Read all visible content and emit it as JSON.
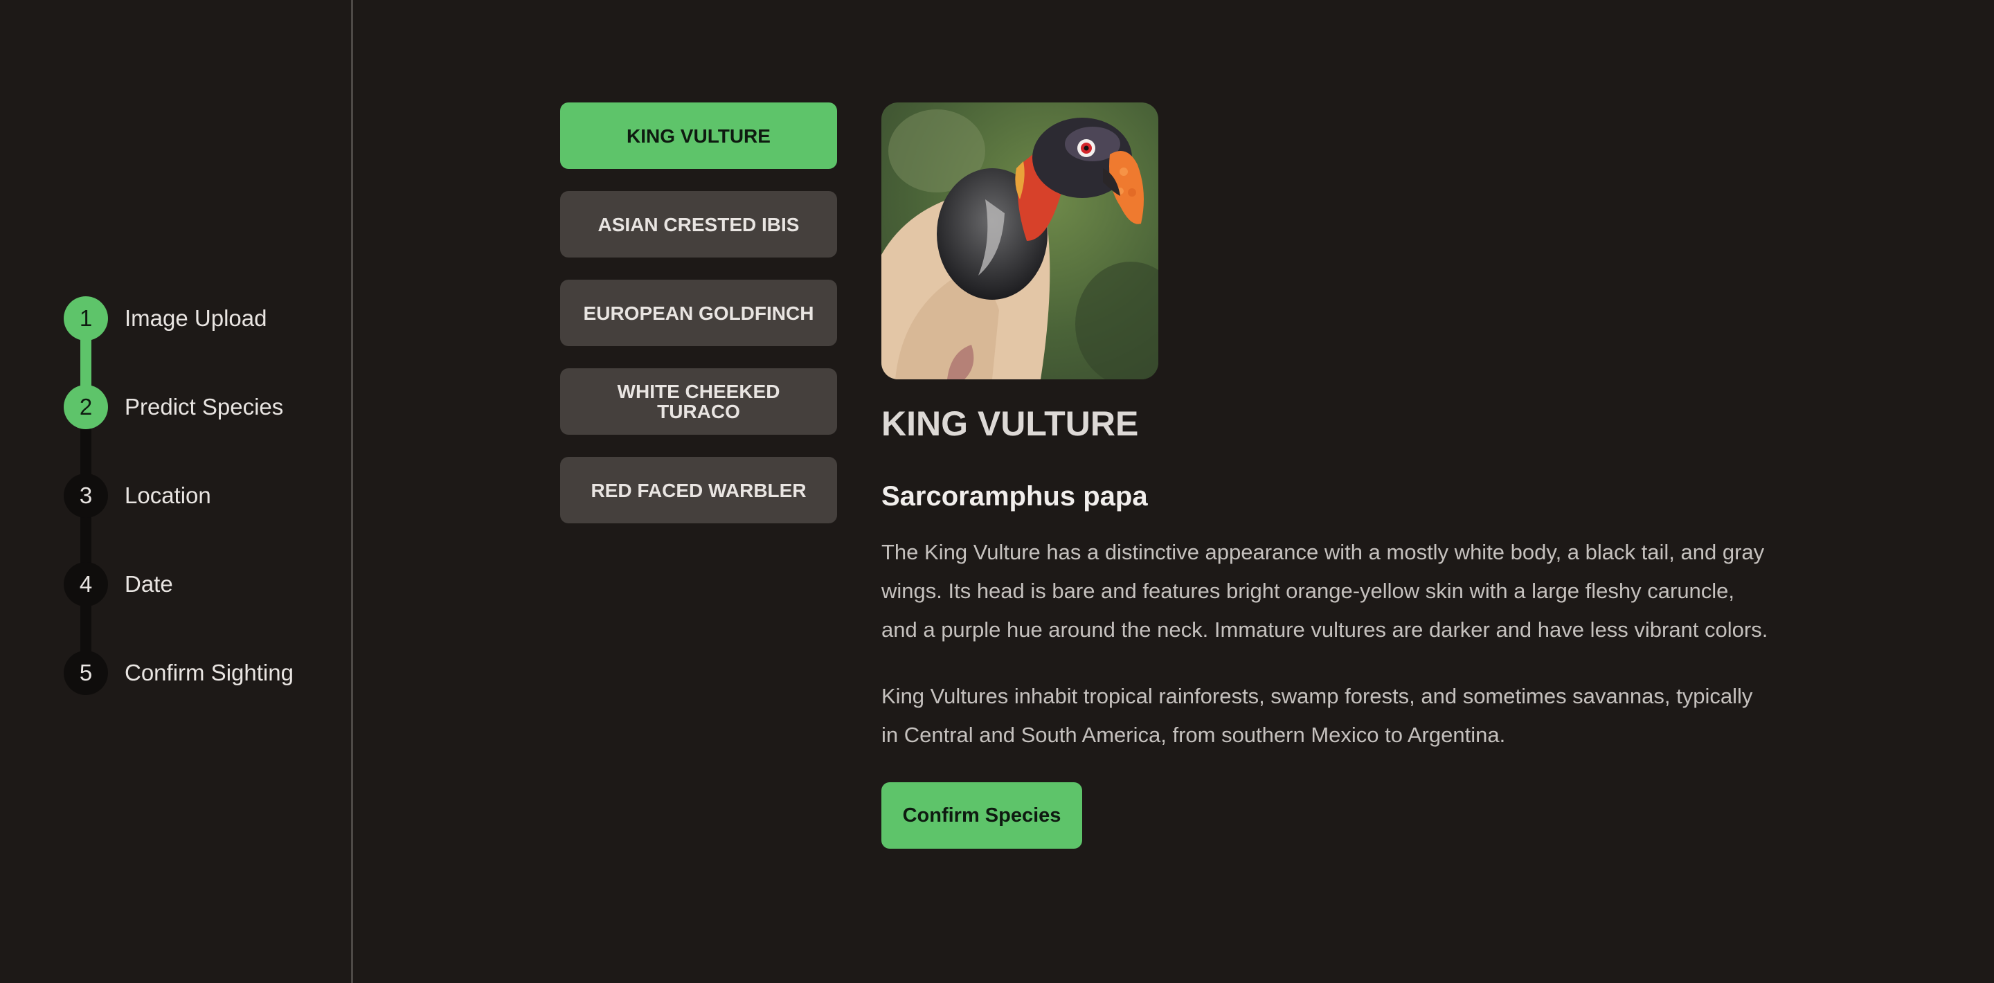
{
  "stepper": {
    "steps": [
      {
        "number": "1",
        "label": "Image Upload",
        "state": "done"
      },
      {
        "number": "2",
        "label": "Predict Species",
        "state": "current"
      },
      {
        "number": "3",
        "label": "Location",
        "state": "pending"
      },
      {
        "number": "4",
        "label": "Date",
        "state": "pending"
      },
      {
        "number": "5",
        "label": "Confirm Sighting",
        "state": "pending"
      }
    ]
  },
  "species_options": [
    {
      "label": "KING VULTURE",
      "selected": true
    },
    {
      "label": "ASIAN CRESTED IBIS",
      "selected": false
    },
    {
      "label": "EUROPEAN GOLDFINCH",
      "selected": false
    },
    {
      "label": "WHITE CHEEKED TURACO",
      "selected": false
    },
    {
      "label": "RED FACED WARBLER",
      "selected": false
    }
  ],
  "detail": {
    "common_name": "KING VULTURE",
    "scientific_name": "Sarcoramphus papa",
    "description": "The King Vulture has a distinctive appearance with a mostly white body, a black tail, and gray wings. Its head is bare and features bright orange-yellow skin with a large fleshy caruncle, and a purple hue around the neck. Immature vultures are darker and have less vibrant colors.",
    "habitat": "King Vultures inhabit tropical rainforests, swamp forests, and sometimes savannas, typically in Central and South America, from southern Mexico to Argentina.",
    "confirm_label": "Confirm Species"
  },
  "colors": {
    "background": "#1d1917",
    "accent": "#5ec46a",
    "button_dark": "#45403d",
    "divider": "#4e4a47"
  }
}
